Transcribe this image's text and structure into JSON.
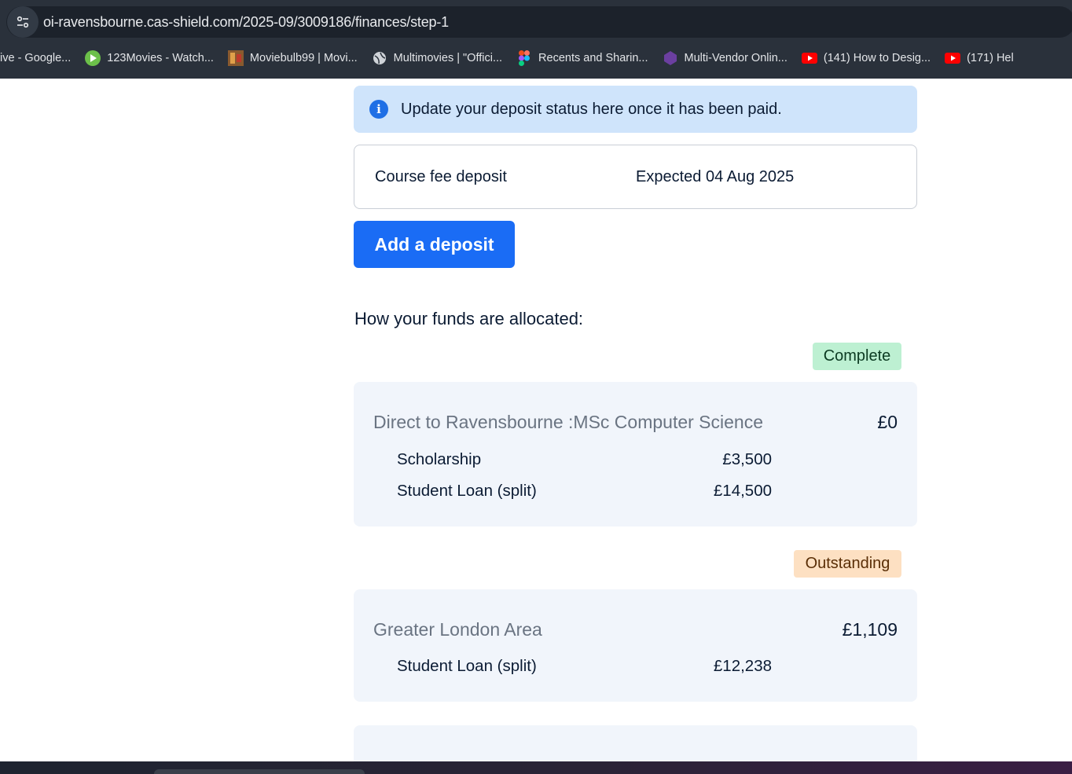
{
  "browser": {
    "url": "oi-ravensbourne.cas-shield.com/2025-09/3009186/finances/step-1",
    "bookmarks": [
      {
        "label": "ive - Google...",
        "icon": "none"
      },
      {
        "label": "123Movies - Watch...",
        "icon": "play-circle-icon",
        "color": "#6cc04a"
      },
      {
        "label": "Moviebulb99 | Movi...",
        "icon": "movie-thumbnail-icon",
        "color": "#c07a3a"
      },
      {
        "label": "Multimovies | \"Offici...",
        "icon": "globe-icon",
        "color": "#cfd3d8"
      },
      {
        "label": "Recents and Sharin...",
        "icon": "figma-icon",
        "color": "#f24e1e"
      },
      {
        "label": "Multi-Vendor Onlin...",
        "icon": "hexagon-icon",
        "color": "#6b3fa0"
      },
      {
        "label": "(141) How to Desig...",
        "icon": "youtube-icon",
        "color": "#ff0000"
      },
      {
        "label": "(171) Hel",
        "icon": "youtube-icon",
        "color": "#ff0000"
      }
    ]
  },
  "page": {
    "info_banner": "Update your deposit status here once it has been paid.",
    "deposit": {
      "label": "Course fee deposit",
      "expected": "Expected 04 Aug 2025"
    },
    "add_deposit_button": "Add a deposit",
    "allocation_heading": "How your funds are allocated:",
    "groups": [
      {
        "status": "Complete",
        "title": "Direct to Ravensbourne :MSc Computer Science",
        "total": "£0",
        "rows": [
          {
            "label": "Scholarship",
            "amount": "£3,500"
          },
          {
            "label": "Student Loan (split)",
            "amount": "£14,500"
          }
        ]
      },
      {
        "status": "Outstanding",
        "title": "Greater London Area",
        "total": "£1,109",
        "rows": [
          {
            "label": "Student Loan (split)",
            "amount": "£12,238"
          }
        ]
      }
    ]
  },
  "colors": {
    "primary": "#1a6cf5",
    "info_bg": "#cfe4fb",
    "complete_bg": "#bdf0d2",
    "outstanding_bg": "#fde0c2",
    "card_bg": "#f1f5fb"
  }
}
